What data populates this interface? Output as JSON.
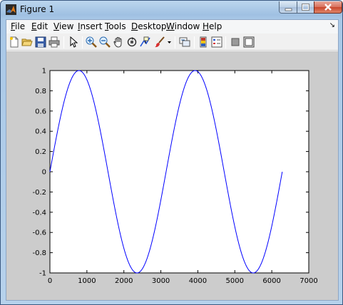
{
  "window": {
    "title": "Figure 1"
  },
  "menu": {
    "items": [
      {
        "mnemonic": "F",
        "rest": "ile"
      },
      {
        "mnemonic": "E",
        "rest": "dit"
      },
      {
        "mnemonic": "V",
        "rest": "iew"
      },
      {
        "mnemonic": "I",
        "rest": "nsert"
      },
      {
        "mnemonic": "T",
        "rest": "ools"
      },
      {
        "mnemonic": "D",
        "rest": "esktop"
      },
      {
        "mnemonic": "W",
        "rest": "indow"
      },
      {
        "mnemonic": "H",
        "rest": "elp"
      }
    ],
    "dock_glyph": "↘"
  },
  "toolbar": {
    "icons": [
      "new-figure-icon",
      "open-file-icon",
      "save-icon",
      "print-icon",
      "select-arrow-icon",
      "zoom-in-icon",
      "zoom-out-icon",
      "pan-hand-icon",
      "rotate-3d-icon",
      "data-cursor-icon",
      "brush-icon",
      "brush-dropdown-icon",
      "link-plot-icon",
      "insert-colorbar-icon",
      "insert-legend-icon",
      "hide-plot-tools-icon",
      "show-plot-tools-icon"
    ]
  },
  "colors": {
    "line": "#0000ff",
    "figure_background": "#cccccc",
    "axes_background": "#ffffff"
  },
  "chart_data": {
    "type": "line",
    "function": "sin(x/500)",
    "x_start": 0,
    "x_end": 6283,
    "x": [
      0,
      250,
      500,
      750,
      785,
      1000,
      1250,
      1500,
      1571,
      1750,
      2000,
      2250,
      2356,
      2500,
      2750,
      3000,
      3142,
      3250,
      3500,
      3750,
      3927,
      4000,
      4250,
      4500,
      4712,
      4750,
      5000,
      5250,
      5498,
      5500,
      5750,
      6000,
      6283
    ],
    "y": [
      0,
      0.479,
      0.841,
      0.997,
      1.0,
      0.909,
      0.598,
      0.141,
      0.0,
      -0.351,
      -0.757,
      -0.978,
      -1.0,
      -0.959,
      -0.706,
      -0.279,
      0.0,
      0.215,
      0.657,
      0.938,
      1.0,
      0.989,
      0.798,
      0.412,
      0.0,
      -0.077,
      -0.544,
      -0.88,
      -1.0,
      -1.0,
      -0.875,
      -0.537,
      0.0
    ],
    "xlim": [
      0,
      7000
    ],
    "ylim": [
      -1,
      1
    ],
    "xticks": [
      0,
      1000,
      2000,
      3000,
      4000,
      5000,
      6000,
      7000
    ],
    "yticks": [
      -1,
      -0.8,
      -0.6,
      -0.4,
      -0.2,
      0,
      0.2,
      0.4,
      0.6,
      0.8,
      1
    ],
    "xtick_labels": [
      "0",
      "1000",
      "2000",
      "3000",
      "4000",
      "5000",
      "6000",
      "7000"
    ],
    "ytick_labels": [
      "-1",
      "-0.8",
      "-0.6",
      "-0.4",
      "-0.2",
      "0",
      "0.2",
      "0.4",
      "0.6",
      "0.8",
      "1"
    ],
    "title": "",
    "xlabel": "",
    "ylabel": "",
    "grid": false
  }
}
